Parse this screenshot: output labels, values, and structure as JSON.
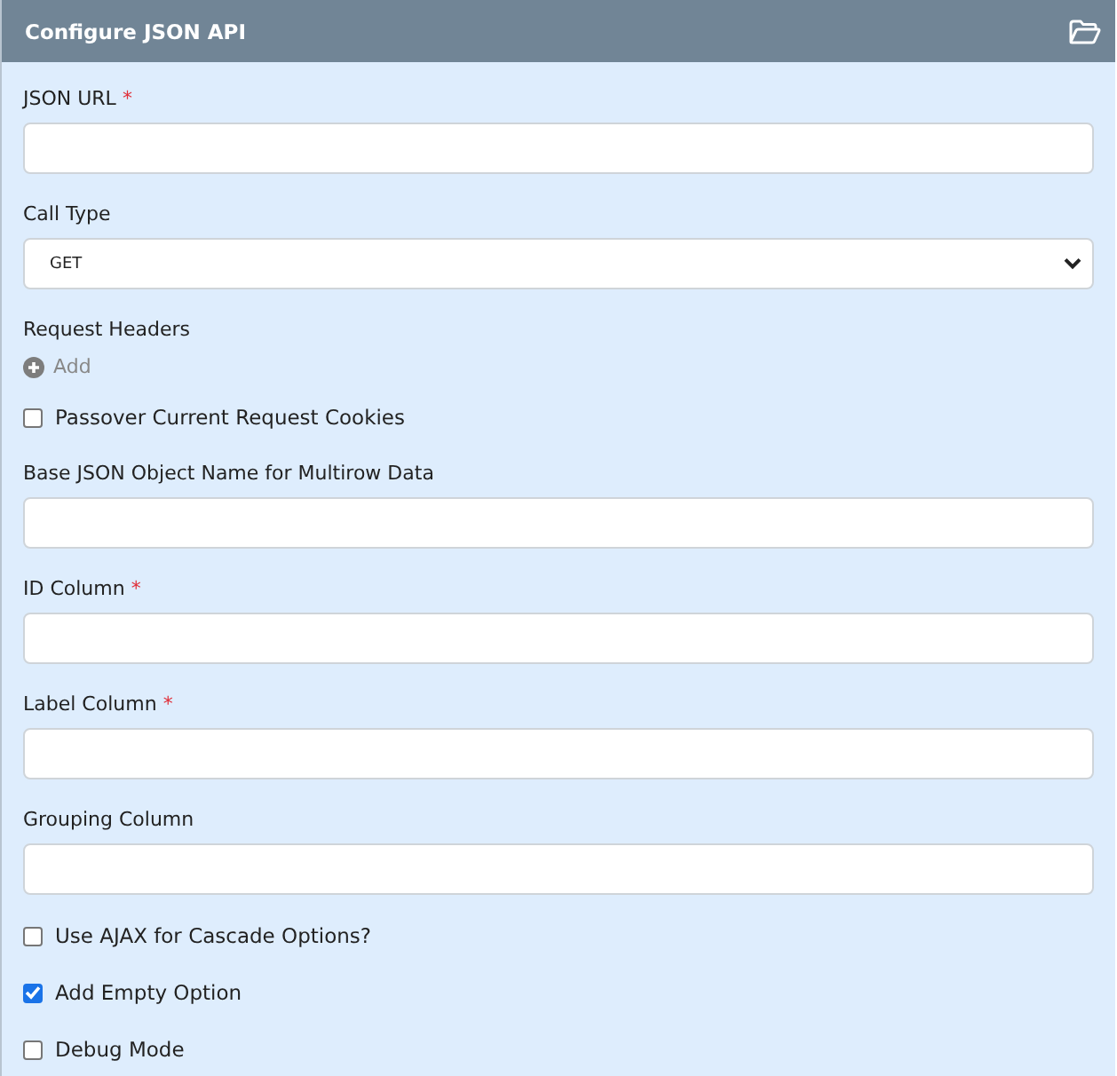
{
  "panel": {
    "title": "Configure JSON API"
  },
  "fields": [
    {
      "kind": "text",
      "label": "JSON URL",
      "required_mark": "*"
    },
    {
      "kind": "select",
      "label": "Call Type",
      "value": "GET"
    },
    {
      "kind": "headers",
      "label": "Request Headers",
      "add_label": "Add"
    },
    {
      "kind": "checkbox",
      "label": "Passover Current Request Cookies",
      "checked": false
    },
    {
      "kind": "text",
      "label": "Base JSON Object Name for Multirow Data"
    },
    {
      "kind": "text",
      "label": "ID Column",
      "required_mark": "*"
    },
    {
      "kind": "text",
      "label": "Label Column",
      "required_mark": "*"
    },
    {
      "kind": "text",
      "label": "Grouping Column"
    },
    {
      "kind": "checkbox",
      "label": "Use AJAX for Cascade Options?",
      "checked": false
    },
    {
      "kind": "checkbox",
      "label": "Add Empty Option",
      "checked": true
    },
    {
      "kind": "checkbox",
      "label": "Debug Mode",
      "checked": false
    }
  ]
}
